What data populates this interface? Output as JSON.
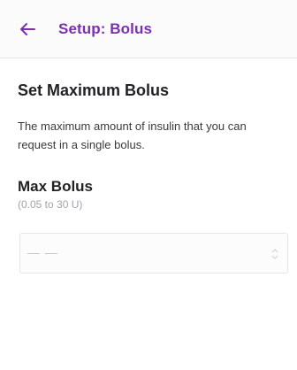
{
  "header": {
    "title": "Setup: Bolus",
    "back_icon": "arrow-left-icon",
    "accent_color": "#7a2fb3"
  },
  "main": {
    "heading": "Set Maximum Bolus",
    "description": "The maximum amount of insulin that you can request in a single bolus.",
    "field": {
      "label": "Max Bolus",
      "hint": "(0.05 to 30 U)",
      "value": "— —",
      "stepper_icon": "stepper-arrows-icon"
    }
  }
}
